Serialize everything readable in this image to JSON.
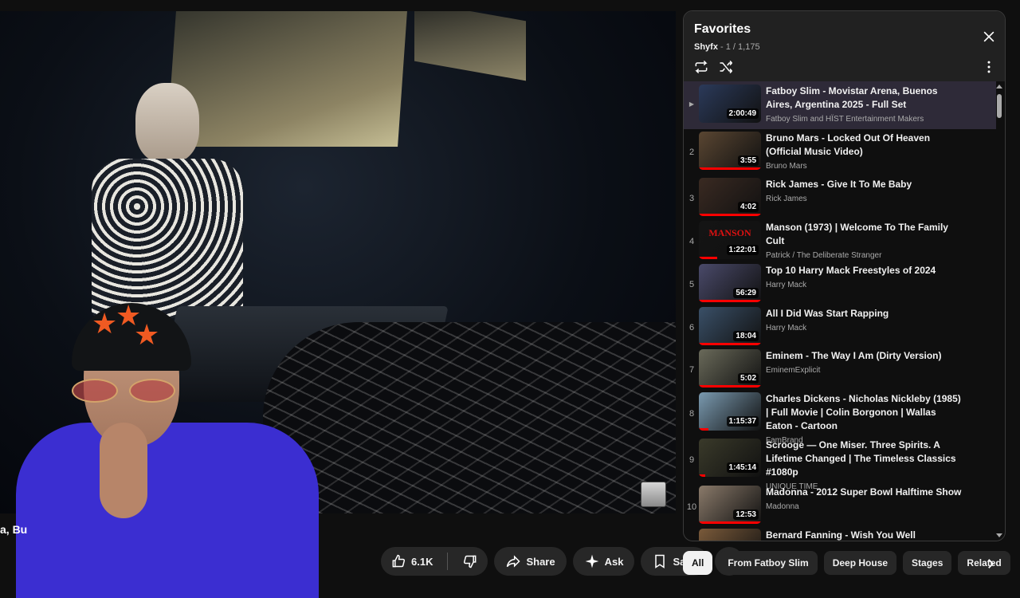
{
  "video": {
    "title_peek": "a, Bu"
  },
  "actions": {
    "like_count": "6.1K",
    "share_label": "Share",
    "ask_label": "Ask",
    "save_label": "Save"
  },
  "playlist": {
    "title": "Favorites",
    "owner": "Shyfx",
    "position": " - 1 / 1,175",
    "items": [
      {
        "index": "",
        "title": "Fatboy Slim - Movistar Arena, Buenos Aires, Argentina 2025 - Full Set",
        "channel": "Fatboy Slim and HÏST Entertainment Makers",
        "duration": "2:00:49",
        "thumb_color": "#2b3a5a",
        "progress": 0
      },
      {
        "index": "2",
        "title": "Bruno Mars - Locked Out Of Heaven (Official Music Video)",
        "channel": "Bruno Mars",
        "duration": "3:55",
        "thumb_color": "#5a4632",
        "progress": 1
      },
      {
        "index": "3",
        "title": "Rick James - Give It To Me Baby",
        "channel": "Rick James",
        "duration": "4:02",
        "thumb_color": "#3a2a22",
        "progress": 1
      },
      {
        "index": "4",
        "title": "Manson (1973) | Welcome To The Family Cult",
        "channel": "Patrick / The Deliberate Stranger",
        "duration": "1:22:01",
        "thumb_color": "#141414",
        "thumb_text": "MANSON",
        "progress": 0.3
      },
      {
        "index": "5",
        "title": "Top 10 Harry Mack Freestyles of 2024",
        "channel": "Harry Mack",
        "duration": "56:29",
        "thumb_color": "#4a4a6a",
        "progress": 1
      },
      {
        "index": "6",
        "title": "All I Did Was Start Rapping",
        "channel": "Harry Mack",
        "duration": "18:04",
        "thumb_color": "#3a5068",
        "progress": 1
      },
      {
        "index": "7",
        "title": "Eminem - The Way I Am (Dirty Version)",
        "channel": "EminemExplicit",
        "duration": "5:02",
        "thumb_color": "#6a6a5a",
        "progress": 1
      },
      {
        "index": "8",
        "title": "Charles Dickens - Nicholas Nickleby (1985) | Full Movie | Colin Borgonon | Wallas Eaton - Cartoon",
        "channel": "FamBrand",
        "duration": "1:15:37",
        "thumb_color": "#7a9ab0",
        "progress": 0.15
      },
      {
        "index": "9",
        "title": "Scrooge — One Miser. Three Spirits. A Lifetime Changed | The Timeless Classics #1080p",
        "channel": "UNIQUE TIME",
        "duration": "1:45:14",
        "thumb_color": "#3a3a2a",
        "progress": 0.1
      },
      {
        "index": "10",
        "title": "Madonna - 2012 Super Bowl Halftime Show",
        "channel": "Madonna",
        "duration": "12:53",
        "thumb_color": "#8a7a6a",
        "progress": 1
      },
      {
        "index": "",
        "title": "Bernard Fanning - Wish You Well",
        "channel": "",
        "duration": "",
        "thumb_color": "#7a5a3a",
        "progress": 0
      }
    ]
  },
  "chips": [
    "All",
    "From Fatboy Slim",
    "Deep House",
    "Stages",
    "Related"
  ],
  "colors": {
    "accent_red": "#ff0000",
    "active_row": "#2e2a38",
    "chip_bg": "#272727"
  }
}
